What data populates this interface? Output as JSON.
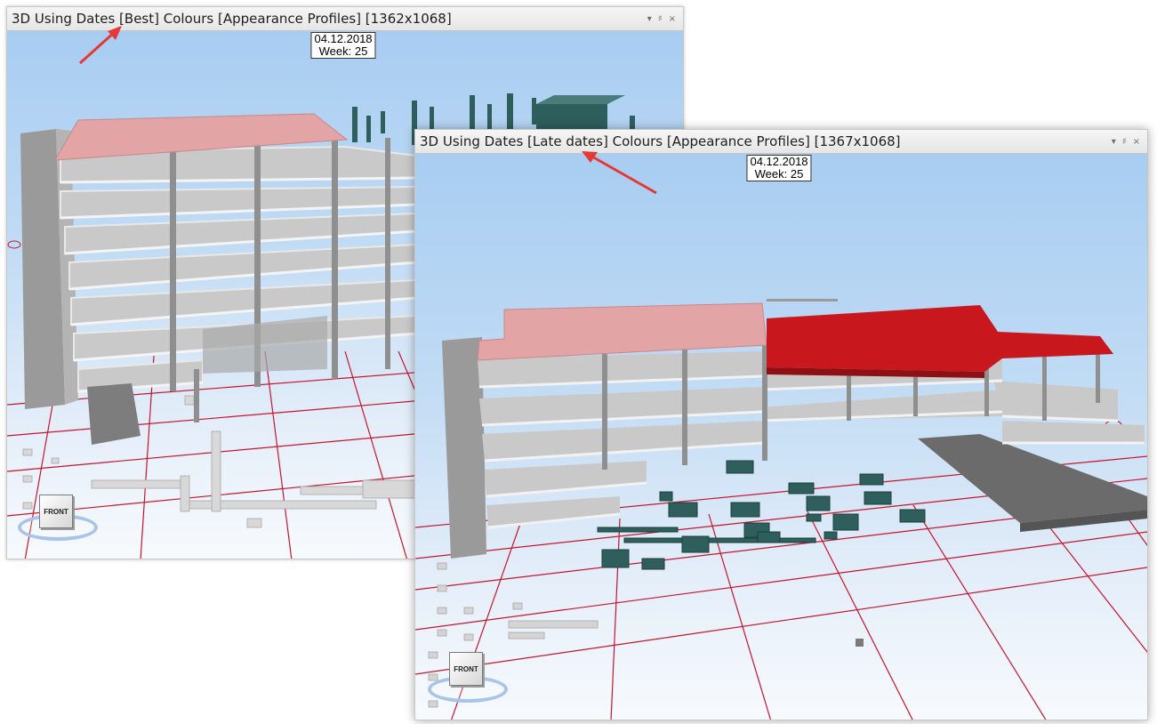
{
  "panels": [
    {
      "title": "3D Using Dates [Best] Colours [Appearance Profiles]  [1362x1068]",
      "date": "04.12.2018",
      "week": "Week: 25",
      "cube_label": "FRONT",
      "controls": [
        "▾",
        "♯",
        "×"
      ]
    },
    {
      "title": "3D Using Dates [Late dates] Colours [Appearance Profiles]  [1367x1068]",
      "date": "04.12.2018",
      "week": "Week: 25",
      "cube_label": "FRONT",
      "controls": [
        "▾",
        "♯",
        "×"
      ]
    }
  ],
  "colors": {
    "grid_line": "#c8142c",
    "slab_grey": "#cfcfcf",
    "column_grey": "#9a9a9a",
    "roof_pink": "#e2a4a4",
    "roof_red": "#c8181e",
    "foundation_teal": "#2e5f5c",
    "arrow_red": "#e53935"
  },
  "icons": {
    "minimize": "chevron-down-icon",
    "pin": "pin-icon",
    "close": "close-icon"
  }
}
